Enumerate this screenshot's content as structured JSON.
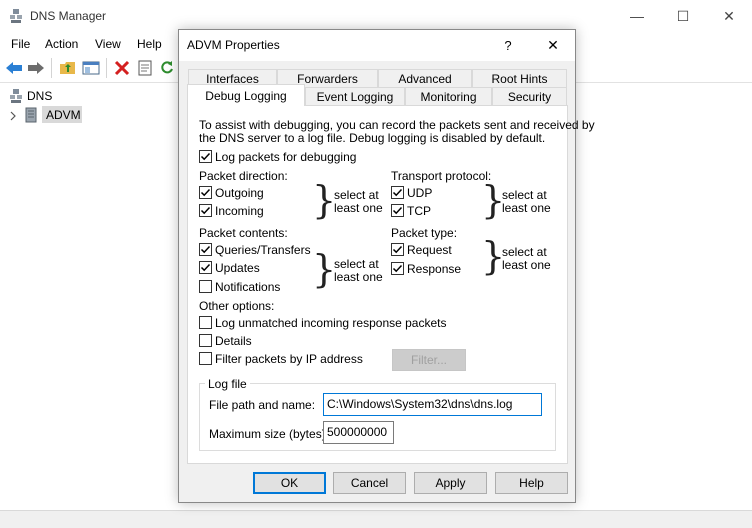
{
  "main_window": {
    "title": "DNS Manager",
    "controls": {
      "minimize": "—",
      "maximize": "☐",
      "close": "✕"
    },
    "menu": [
      "File",
      "Action",
      "View",
      "Help"
    ],
    "toolbar_icons": [
      "back-arrow-icon",
      "forward-arrow-icon",
      "folder-up-icon",
      "show-hide-tree-icon",
      "delete-icon",
      "properties-icon",
      "refresh-icon"
    ],
    "tree": {
      "root": "DNS",
      "server": "ADVM"
    }
  },
  "dialog": {
    "title": "ADVM Properties",
    "help_glyph": "?",
    "close_glyph": "✕",
    "tabs_row1": [
      "Interfaces",
      "Forwarders",
      "Advanced",
      "Root Hints"
    ],
    "tabs_row2": [
      "Debug Logging",
      "Event Logging",
      "Monitoring",
      "Security"
    ],
    "active_tab": "Debug Logging",
    "description_line1": "To assist with debugging, you can record the packets sent and received by",
    "description_line2": "the DNS server to a log file. Debug logging is disabled by default.",
    "log_packets": {
      "label": "Log packets for debugging",
      "checked": true
    },
    "packet_direction": {
      "heading": "Packet direction:",
      "items": [
        {
          "label": "Outgoing",
          "checked": true
        },
        {
          "label": "Incoming",
          "checked": true
        }
      ],
      "note_line1": "select at",
      "note_line2": "least one"
    },
    "transport_protocol": {
      "heading": "Transport protocol:",
      "items": [
        {
          "label": "UDP",
          "checked": true
        },
        {
          "label": "TCP",
          "checked": true
        }
      ],
      "note_line1": "select at",
      "note_line2": "least one"
    },
    "packet_contents": {
      "heading": "Packet contents:",
      "items": [
        {
          "label": "Queries/Transfers",
          "checked": true
        },
        {
          "label": "Updates",
          "checked": true
        },
        {
          "label": "Notifications",
          "checked": false
        }
      ],
      "note_line1": "select at",
      "note_line2": "least one"
    },
    "packet_type": {
      "heading": "Packet type:",
      "items": [
        {
          "label": "Request",
          "checked": true
        },
        {
          "label": "Response",
          "checked": true
        }
      ],
      "note_line1": "select at",
      "note_line2": "least one"
    },
    "other_options": {
      "heading": "Other options:",
      "items": [
        {
          "label": "Log unmatched incoming response packets",
          "checked": false
        },
        {
          "label": "Details",
          "checked": false
        },
        {
          "label": "Filter packets by IP address",
          "checked": false
        }
      ],
      "filter_button": "Filter..."
    },
    "log_file": {
      "heading": "Log file",
      "path_label": "File path and name:",
      "path_value": "C:\\Windows\\System32\\dns\\dns.log",
      "size_label": "Maximum size (bytes):",
      "size_value": "500000000"
    },
    "buttons": {
      "ok": "OK",
      "cancel": "Cancel",
      "apply": "Apply",
      "help": "Help"
    },
    "colors": {
      "focus_blue": "#0078d7",
      "check": "#000000"
    }
  }
}
